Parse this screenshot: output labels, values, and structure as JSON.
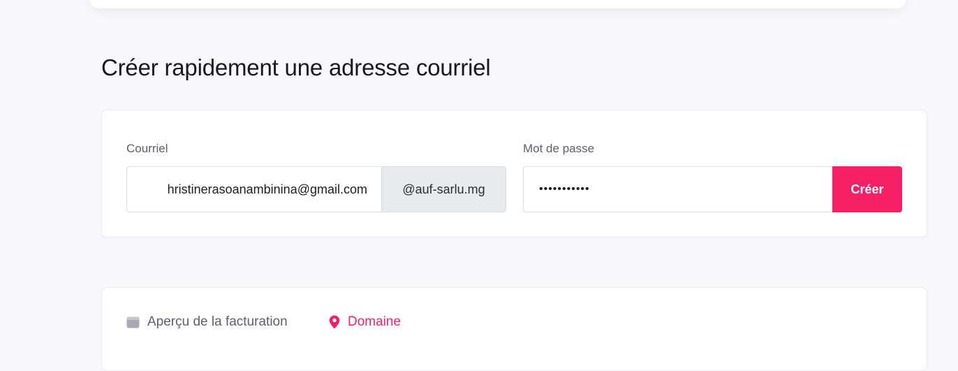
{
  "page": {
    "title": "Créer rapidement une adresse courriel"
  },
  "create_form": {
    "email_label": "Courriel",
    "email_value": "hristinerasoanambinina@gmail.com",
    "domain_suffix": "@auf-sarlu.mg",
    "password_label": "Mot de passe",
    "password_value": "•••••••••••",
    "submit_label": "Créer"
  },
  "tabs": [
    {
      "label": "Aperçu de la facturation",
      "icon": "wallet-icon",
      "active": false
    },
    {
      "label": "Domaine",
      "icon": "map-pin-icon",
      "active": true
    }
  ],
  "colors": {
    "accent": "#f41f65",
    "muted_text": "#5e5e6c",
    "suffix_background": "#e9eaed"
  }
}
